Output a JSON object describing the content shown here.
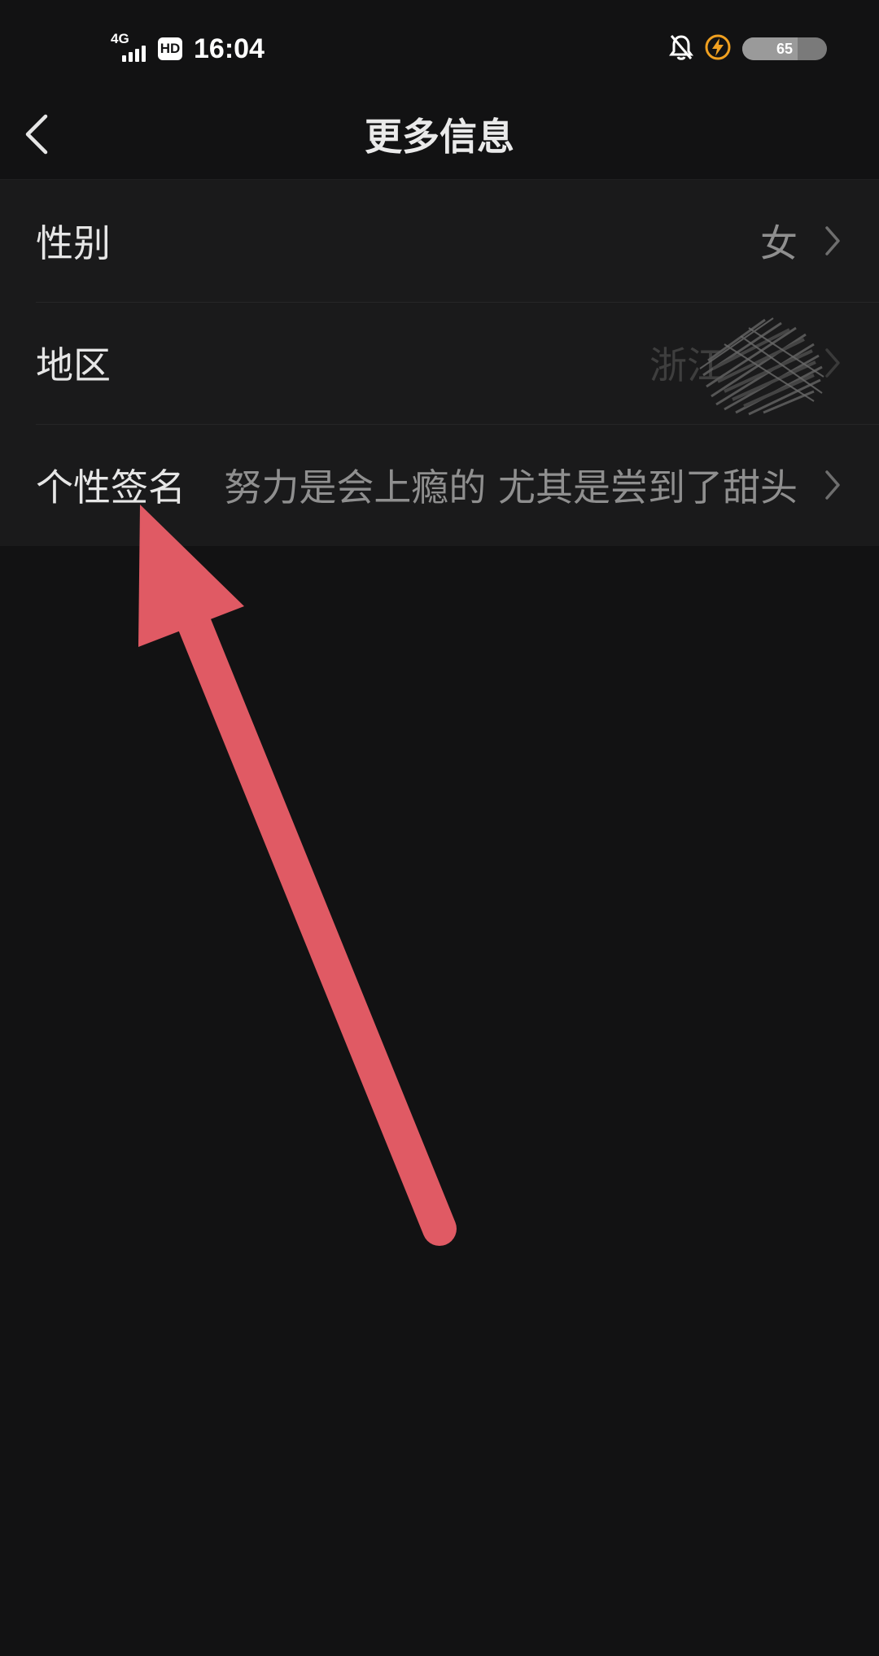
{
  "status_bar": {
    "network": "4G",
    "hd": "HD",
    "time": "16:04",
    "battery_percent": "65",
    "battery_level": 0.65,
    "icons": [
      "signal-icon",
      "hd-icon",
      "bell-muted-icon",
      "charging-icon",
      "battery-icon"
    ]
  },
  "nav": {
    "title": "更多信息",
    "back_icon": "back-chevron-icon"
  },
  "rows": [
    {
      "label": "性别",
      "value": "女"
    },
    {
      "label": "地区",
      "value": "浙江"
    },
    {
      "label": "个性签名",
      "value": "努力是会上瘾的 尤其是尝到了甜头"
    }
  ],
  "colors": {
    "background": "#121213",
    "list_background": "#1a1a1b",
    "arrow": "#e05a64",
    "charging": "#f0a020"
  }
}
